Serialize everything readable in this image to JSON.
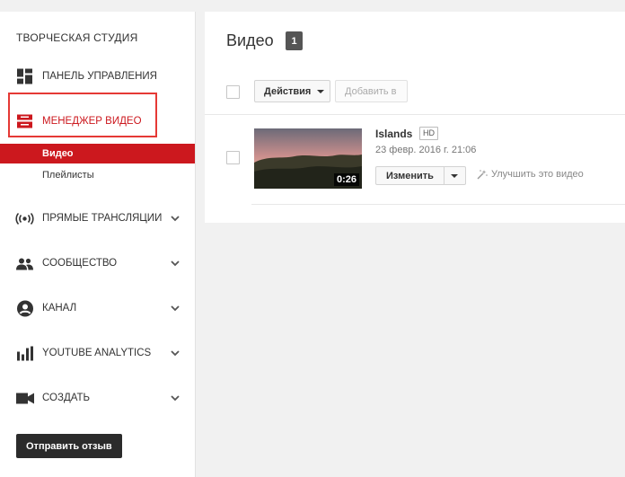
{
  "sidebar": {
    "studio_title": "ТВОРЧЕСКАЯ СТУДИЯ",
    "items": [
      {
        "label": "ПАНЕЛЬ УПРАВЛЕНИЯ",
        "icon": "dashboard-icon"
      },
      {
        "label": "МЕНЕДЖЕР ВИДЕО",
        "icon": "video-manager-icon",
        "active": true
      },
      {
        "label": "ПРЯМЫЕ ТРАНСЛЯЦИИ",
        "icon": "live-broadcast-icon"
      },
      {
        "label": "СООБЩЕСТВО",
        "icon": "community-icon"
      },
      {
        "label": "КАНАЛ",
        "icon": "channel-icon"
      },
      {
        "label": "YOUTUBE ANALYTICS",
        "icon": "analytics-icon"
      },
      {
        "label": "СОЗДАТЬ",
        "icon": "create-icon"
      }
    ],
    "subitems": [
      {
        "label": "Видео",
        "selected": true
      },
      {
        "label": "Плейлисты",
        "selected": false
      }
    ],
    "feedback_label": "Отправить отзыв"
  },
  "main": {
    "title": "Видео",
    "count": "1",
    "actions_label": "Действия",
    "add_to_label": "Добавить в",
    "videos": [
      {
        "title": "Islands",
        "quality": "HD",
        "date": "23 февр. 2016 г. 21:06",
        "duration": "0:26",
        "edit_label": "Изменить",
        "enhance_label": "Улучшить это видео"
      }
    ]
  },
  "colors": {
    "accent": "#cc181e",
    "highlight_box": "#e53935",
    "background": "#f1f1f1"
  }
}
